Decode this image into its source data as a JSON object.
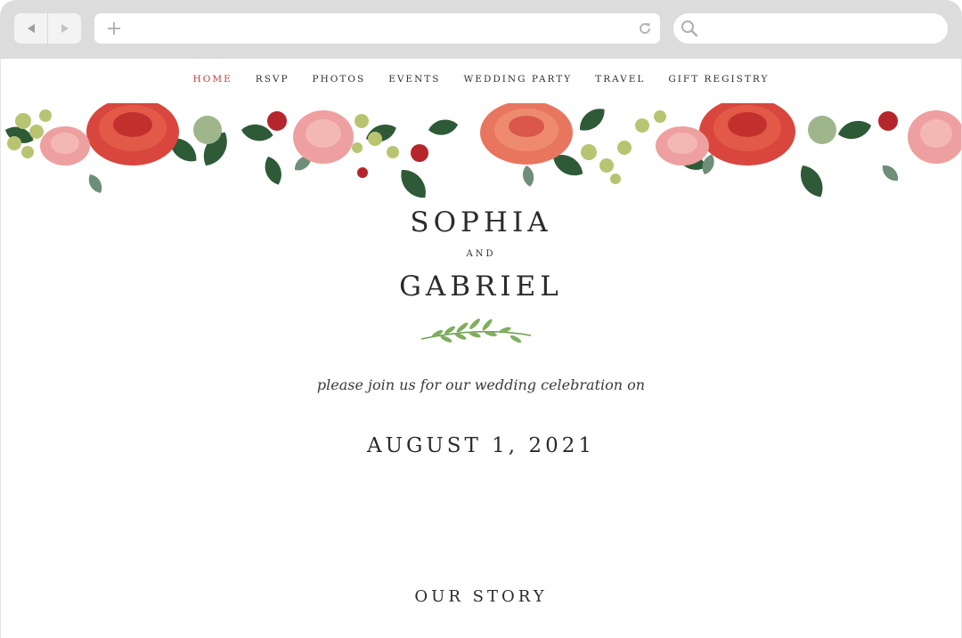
{
  "browser": {
    "back_icon": "back-arrow-icon",
    "forward_icon": "forward-arrow-icon",
    "new_tab_icon": "plus-icon",
    "reload_icon": "reload-icon",
    "search_icon": "search-icon",
    "address_value": "",
    "search_value": ""
  },
  "nav": {
    "items": [
      {
        "label": "HOME",
        "active": true
      },
      {
        "label": "RSVP"
      },
      {
        "label": "PHOTOS"
      },
      {
        "label": "EVENTS"
      },
      {
        "label": "WEDDING PARTY"
      },
      {
        "label": "TRAVEL"
      },
      {
        "label": "GIFT REGISTRY"
      }
    ],
    "active_color": "#c23b3f"
  },
  "hero": {
    "name1": "SOPHIA",
    "and": "AND",
    "name2": "GABRIEL",
    "invite": "please join us for our wedding celebration on",
    "date": "AUGUST 1, 2021"
  },
  "sections": {
    "story_title": "OUR STORY"
  },
  "colors": {
    "chrome": "#dcdcdc",
    "accent_red": "#c23b3f",
    "text": "#2b2b2b"
  }
}
